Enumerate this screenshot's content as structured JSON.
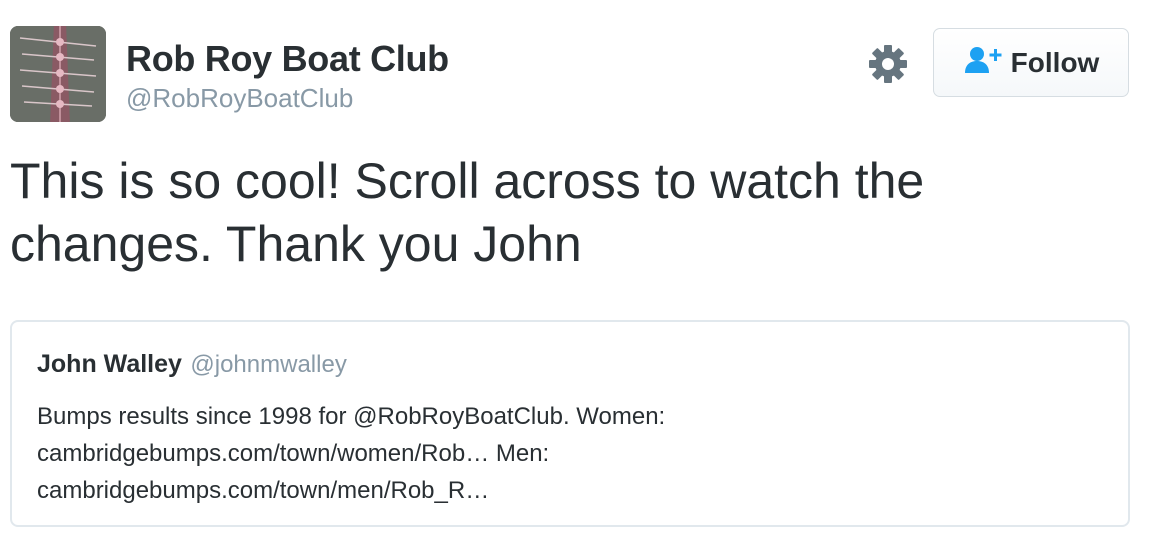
{
  "author": {
    "name": "Rob Roy Boat Club",
    "handle": "@RobRoyBoatClub",
    "avatar": "rowing-crew-photo"
  },
  "actions": {
    "settings_icon": "gear-icon",
    "follow_label": "Follow",
    "follow_icon": "add-user-icon",
    "accent_color": "#1da1f2"
  },
  "tweet": {
    "text": "This is so cool! Scroll across to watch the changes. Thank you John"
  },
  "quoted": {
    "name": "John Walley",
    "handle": "@johnmwalley",
    "lines": [
      "Bumps results since 1998 for @RobRoyBoatClub. Women:",
      "cambridgebumps.com/town/women/Rob… Men:",
      "cambridgebumps.com/town/men/Rob_R…"
    ]
  }
}
